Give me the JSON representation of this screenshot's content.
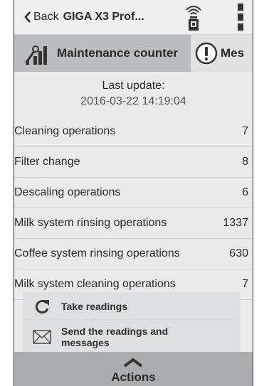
{
  "topbar": {
    "back_label": "Back",
    "device_title": "GIGA X3 Prof..."
  },
  "tabs": [
    {
      "label": "Maintenance counter",
      "icon": "tools-chart-icon",
      "active": true
    },
    {
      "label": "Mes",
      "icon": "exclamation-icon",
      "active": false
    }
  ],
  "update": {
    "label": "Last update:",
    "value": "2016-03-22 14:19:04"
  },
  "counters": [
    {
      "label": "Cleaning operations",
      "value": "7"
    },
    {
      "label": "Filter change",
      "value": "8"
    },
    {
      "label": "Descaling operations",
      "value": "6"
    },
    {
      "label": "Milk system rinsing operations",
      "value": "1337"
    },
    {
      "label": "Coffee system rinsing operations",
      "value": "630"
    },
    {
      "label": "Milk system cleaning operations",
      "value": "7"
    }
  ],
  "actions_menu": {
    "take_readings": "Take readings",
    "send_readings": "Send the readings and messages",
    "toggle_label": "Actions"
  },
  "colors": {
    "tab_active_bg": "#b9bdc0",
    "actions_bar_bg": "#a9adb0",
    "panel_bg": "#e8eaeb"
  }
}
